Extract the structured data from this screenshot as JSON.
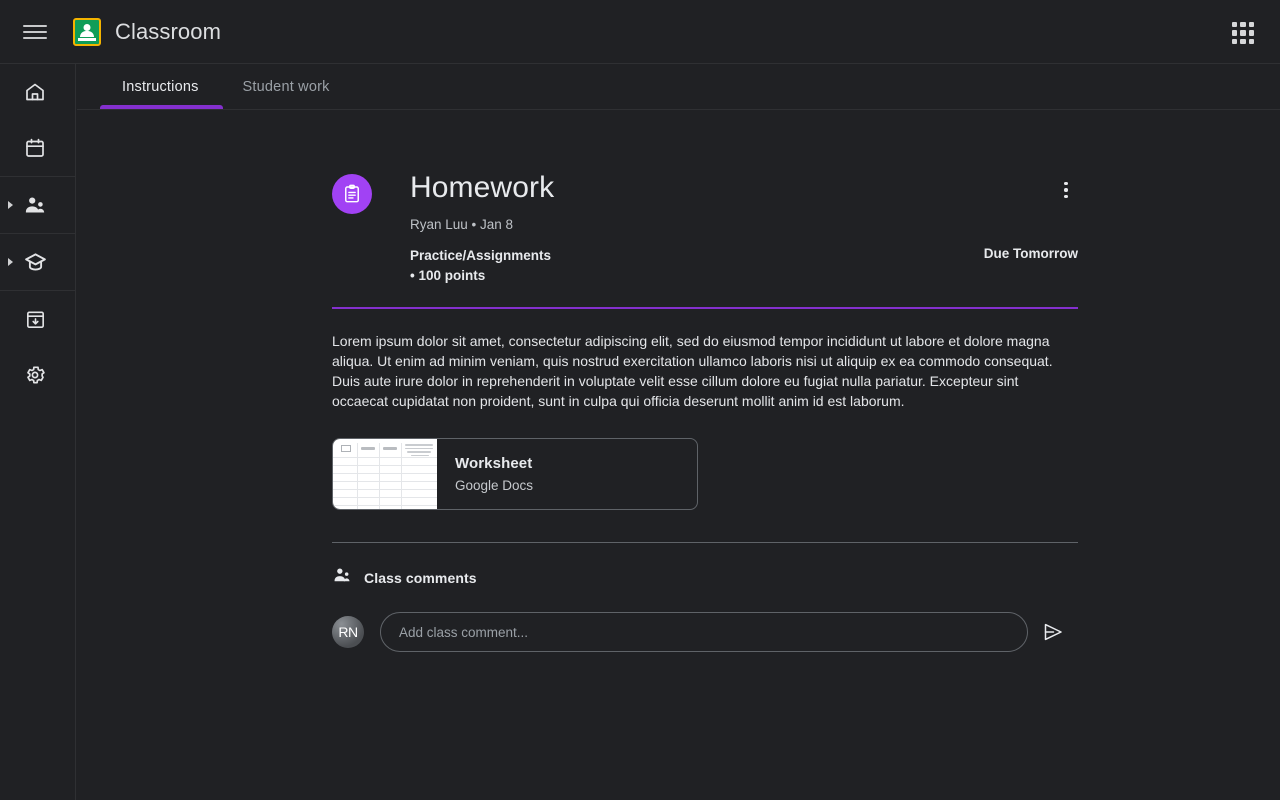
{
  "topbar": {
    "menu_icon": "hamburger-menu-icon",
    "logo_icon": "google-classroom-logo-icon",
    "title": "Classroom",
    "apps_icon": "apps-grid-icon"
  },
  "sidebar": {
    "sections": [
      {
        "items": [
          {
            "icon": "home-icon",
            "name": "home",
            "expandable": false
          },
          {
            "icon": "calendar-icon",
            "name": "calendar",
            "expandable": false
          }
        ]
      },
      {
        "items": [
          {
            "icon": "people-teaching-icon",
            "name": "teaching",
            "expandable": true
          }
        ]
      },
      {
        "items": [
          {
            "icon": "graduation-cap-icon",
            "name": "enrolled",
            "expandable": true
          }
        ]
      },
      {
        "items": [
          {
            "icon": "archive-box-icon",
            "name": "archived-classes",
            "expandable": false
          },
          {
            "icon": "gear-icon",
            "name": "settings",
            "expandable": false
          }
        ]
      }
    ]
  },
  "tabs": [
    {
      "label": "Instructions",
      "active": true
    },
    {
      "label": "Student work",
      "active": false
    }
  ],
  "assignment": {
    "icon": "assignment-clipboard-icon",
    "title": "Homework",
    "author": "Ryan Luu",
    "separator": "•",
    "date": "Jan 8",
    "byline": "Ryan Luu • Jan 8",
    "topic": "Practice/Assignments",
    "points": "• 100 points",
    "due": "Due Tomorrow",
    "menu_icon": "more-vertical-icon",
    "description": "Lorem ipsum dolor sit amet, consectetur adipiscing elit, sed do eiusmod tempor incididunt ut labore et dolore magna aliqua. Ut enim ad minim veniam, quis nostrud exercitation ullamco laboris nisi ut aliquip ex ea commodo consequat. Duis aute irure dolor in reprehenderit in voluptate velit esse cillum dolore eu fugiat nulla pariatur. Excepteur sint occaecat cupidatat non proident, sunt in culpa qui officia deserunt mollit anim id est laborum."
  },
  "attachment": {
    "title": "Worksheet",
    "subtitle": "Google Docs",
    "thumbnail_icon": "document-thumbnail"
  },
  "comments": {
    "icon": "people-icon",
    "label": "Class comments",
    "avatar_initials": "RN",
    "input_value": "",
    "placeholder": "Add class comment...",
    "send_icon": "send-icon"
  },
  "colors": {
    "background": "#202124",
    "accent_purple": "#8430ce",
    "assignment_icon_purple": "#a142f4",
    "divider": "#5f6368",
    "text_primary": "#e8eaed",
    "text_secondary": "#9aa0a6",
    "logo_green": "#0f9d58",
    "logo_yellow": "#f4b400"
  }
}
